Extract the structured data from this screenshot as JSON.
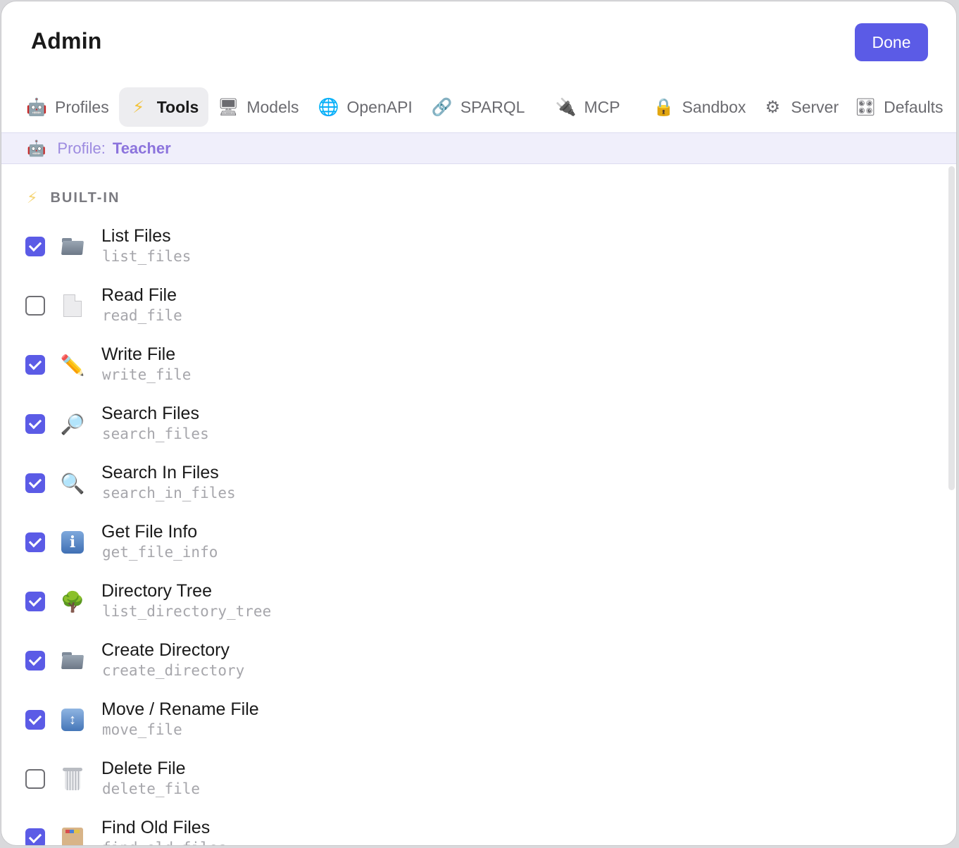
{
  "window": {
    "title": "Admin",
    "done_label": "Done",
    "accent": "#5b5be6"
  },
  "tabs": [
    {
      "label": "Profiles",
      "icon": "robot-icon",
      "glyph": "🤖"
    },
    {
      "label": "Tools",
      "icon": "lightning-icon",
      "glyph": "⚡",
      "active": true
    },
    {
      "label": "Models",
      "icon": "monitor-icon",
      "glyph": "🖥"
    },
    {
      "label": "OpenAPI",
      "icon": "globe-icon",
      "glyph": "🌐"
    },
    {
      "label": "SPARQL",
      "icon": "link-icon",
      "glyph": "🔗"
    },
    {
      "label": "MCP",
      "icon": "plug-icon",
      "glyph": "🔌"
    },
    {
      "label": "Sandbox",
      "icon": "lock-icon",
      "glyph": "🔒"
    },
    {
      "label": "Server",
      "icon": "gear-icon",
      "glyph": "⚙"
    },
    {
      "label": "Defaults",
      "icon": "control-knobs-icon",
      "glyph": "🎛"
    }
  ],
  "profile_bar": {
    "icon": "robot-icon",
    "glyph": "🤖",
    "label": "Profile:",
    "name": "Teacher"
  },
  "section": {
    "icon": "lightning-icon",
    "glyph": "⚡",
    "title": "BUILT-IN"
  },
  "tools": [
    {
      "name": "List Files",
      "id": "list_files",
      "checked": true,
      "icon": "folder-icon"
    },
    {
      "name": "Read File",
      "id": "read_file",
      "checked": false,
      "icon": "document-icon"
    },
    {
      "name": "Write File",
      "id": "write_file",
      "checked": true,
      "icon": "pencil-icon"
    },
    {
      "name": "Search Files",
      "id": "search_files",
      "checked": true,
      "icon": "magnifier-right-icon"
    },
    {
      "name": "Search In Files",
      "id": "search_in_files",
      "checked": true,
      "icon": "magnifier-left-icon"
    },
    {
      "name": "Get File Info",
      "id": "get_file_info",
      "checked": true,
      "icon": "info-icon"
    },
    {
      "name": "Directory Tree",
      "id": "list_directory_tree",
      "checked": true,
      "icon": "tree-icon"
    },
    {
      "name": "Create Directory",
      "id": "create_directory",
      "checked": true,
      "icon": "open-folder-icon"
    },
    {
      "name": "Move / Rename File",
      "id": "move_file",
      "checked": true,
      "icon": "up-down-arrow-icon"
    },
    {
      "name": "Delete File",
      "id": "delete_file",
      "checked": false,
      "icon": "trash-icon"
    },
    {
      "name": "Find Old Files",
      "id": "find_old_files",
      "checked": true,
      "icon": "card-box-icon"
    }
  ]
}
